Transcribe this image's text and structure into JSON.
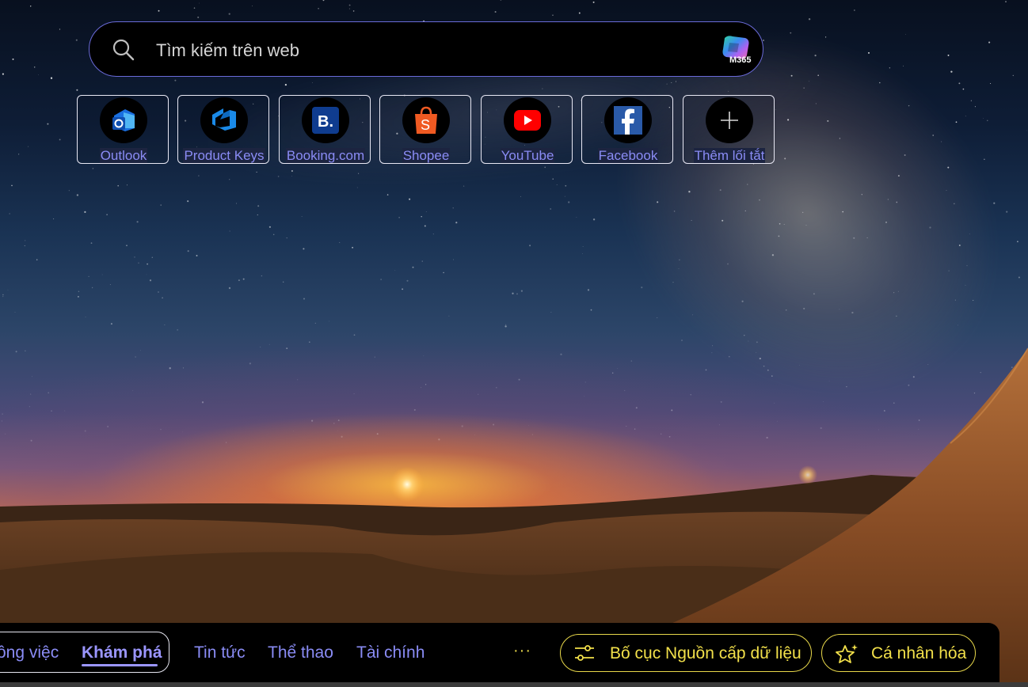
{
  "search": {
    "placeholder": "Tìm kiếm trên web",
    "m365_label": "M365",
    "icon": "search-icon"
  },
  "shortcuts": [
    {
      "label": "Outlook",
      "icon": "outlook-icon"
    },
    {
      "label": "Product Keys",
      "icon": "azure-devops-icon"
    },
    {
      "label": "Booking.com",
      "icon": "booking-icon"
    },
    {
      "label": "Shopee",
      "icon": "shopee-icon"
    },
    {
      "label": "YouTube",
      "icon": "youtube-icon"
    },
    {
      "label": "Facebook",
      "icon": "facebook-icon"
    },
    {
      "label": "Thêm lối tắt",
      "icon": "plus-icon"
    }
  ],
  "feed_nav": {
    "tabs": [
      "ông việc",
      "Khám phá",
      "Tin tức",
      "Thể thao",
      "Tài chính"
    ],
    "active_tab": "Khám phá",
    "more_label": "···",
    "layout_button": "Bố cục Nguồn cấp dữ liệu",
    "personalize_button": "Cá nhân hóa"
  },
  "colors": {
    "accent_link": "#8a8cf5",
    "active_tab": "#9b96ff",
    "button_yellow": "#f2e04a",
    "search_border": "#6a6ad8"
  }
}
